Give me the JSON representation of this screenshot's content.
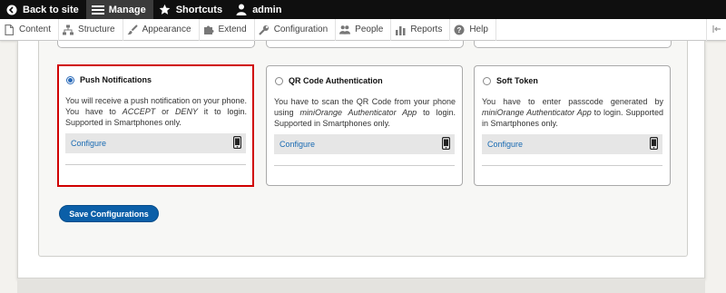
{
  "toolbar": {
    "back_label": "Back to site",
    "manage_label": "Manage",
    "shortcuts_label": "Shortcuts",
    "user_label": "admin"
  },
  "tray": {
    "items": [
      {
        "label": "Content",
        "icon": "page-icon"
      },
      {
        "label": "Structure",
        "icon": "structure-icon"
      },
      {
        "label": "Appearance",
        "icon": "paintbrush-icon"
      },
      {
        "label": "Extend",
        "icon": "puzzle-icon"
      },
      {
        "label": "Configuration",
        "icon": "wrench-icon"
      },
      {
        "label": "People",
        "icon": "people-icon"
      },
      {
        "label": "Reports",
        "icon": "chart-icon"
      },
      {
        "label": "Help",
        "icon": "help-icon"
      }
    ]
  },
  "methods": [
    {
      "title": "Push Notifications",
      "selected": true,
      "desc_1": "You will receive a push notification on your phone. You have to ",
      "desc_em1": "ACCEPT",
      "desc_2": " or ",
      "desc_em2": "DENY",
      "desc_3": " it to login. Supported in Smartphones only.",
      "configure": "Configure",
      "icon": "smartphone-icon"
    },
    {
      "title": "QR Code Authentication",
      "selected": false,
      "desc_1": "You have to scan the QR Code from your phone using ",
      "desc_em1": "miniOrange Authenticator App",
      "desc_2": " to login. Supported in Smartphones only.",
      "configure": "Configure",
      "icon": "smartphone-icon"
    },
    {
      "title": "Soft Token",
      "selected": false,
      "desc_1": "You have to enter passcode generated by ",
      "desc_em1": "miniOrange Authenticator App",
      "desc_2": " to login. Supported in Smartphones only.",
      "configure": "Configure",
      "icon": "smartphone-icon"
    }
  ],
  "save_label": "Save Configurations",
  "colors": {
    "toolbar_bg": "#0f0f0f",
    "active_tab": "#3b3b3b",
    "link": "#1a6bb3",
    "primary_button": "#0b5fa8",
    "selected_border": "#d00000"
  }
}
